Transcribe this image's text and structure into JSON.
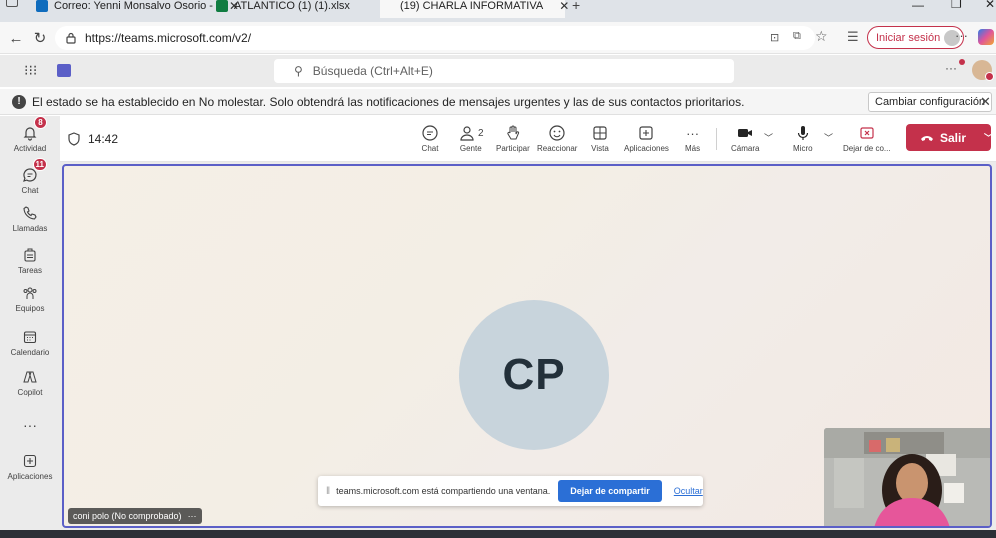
{
  "browser": {
    "tabs": [
      {
        "title": "Correo: Yenni Monsalvo Osorio - ",
        "favicon": "outlook-icon"
      },
      {
        "title": "ATLANTICO (1) (1).xlsx",
        "favicon": "excel-icon"
      },
      {
        "title": "(19) CHARLA INFORMATIVA",
        "favicon": "teams-icon"
      }
    ],
    "url": "https://teams.microsoft.com/v2/",
    "signin_label": "Iniciar sesión"
  },
  "teams": {
    "search_placeholder": "Búsqueda (Ctrl+Alt+E)"
  },
  "banner": {
    "message": "El estado se ha establecido en No molestar. Solo obtendrá las notificaciones de mensajes urgentes y las de sus contactos prioritarios.",
    "button_label": "Cambiar configuración"
  },
  "rail": {
    "items": [
      {
        "label": "Actividad",
        "icon": "bell-icon",
        "badge": "8"
      },
      {
        "label": "Chat",
        "icon": "chat-icon",
        "badge": "11"
      },
      {
        "label": "Llamadas",
        "icon": "phone-icon"
      },
      {
        "label": "Tareas",
        "icon": "tasks-icon"
      },
      {
        "label": "Equipos",
        "icon": "teams-group-icon"
      },
      {
        "label": "Calendario",
        "icon": "calendar-icon"
      },
      {
        "label": "Copilot",
        "icon": "copilot-icon"
      },
      {
        "label": "",
        "icon": "more-icon"
      },
      {
        "label": "Aplicaciones",
        "icon": "apps-icon"
      }
    ]
  },
  "meeting": {
    "timer": "14:42",
    "controls": {
      "chat": "Chat",
      "people": "Gente",
      "people_count": "2",
      "raise": "Participar",
      "react": "Reaccionar",
      "view": "Vista",
      "apps": "Aplicaciones",
      "more": "Más",
      "camera": "Cámara",
      "mic": "Micro",
      "stop_share": "Dejar de co...",
      "leave": "Salir"
    },
    "avatar_initials": "CP",
    "participant_name": "coni polo (No comprobado)",
    "share_bar": {
      "message": "teams.microsoft.com está compartiendo una ventana.",
      "stop_label": "Dejar de compartir",
      "hide_label": "Ocultar"
    }
  },
  "colors": {
    "accent": "#5b5fc7",
    "leave_red": "#c4314b",
    "share_blue": "#2b6fd6"
  }
}
